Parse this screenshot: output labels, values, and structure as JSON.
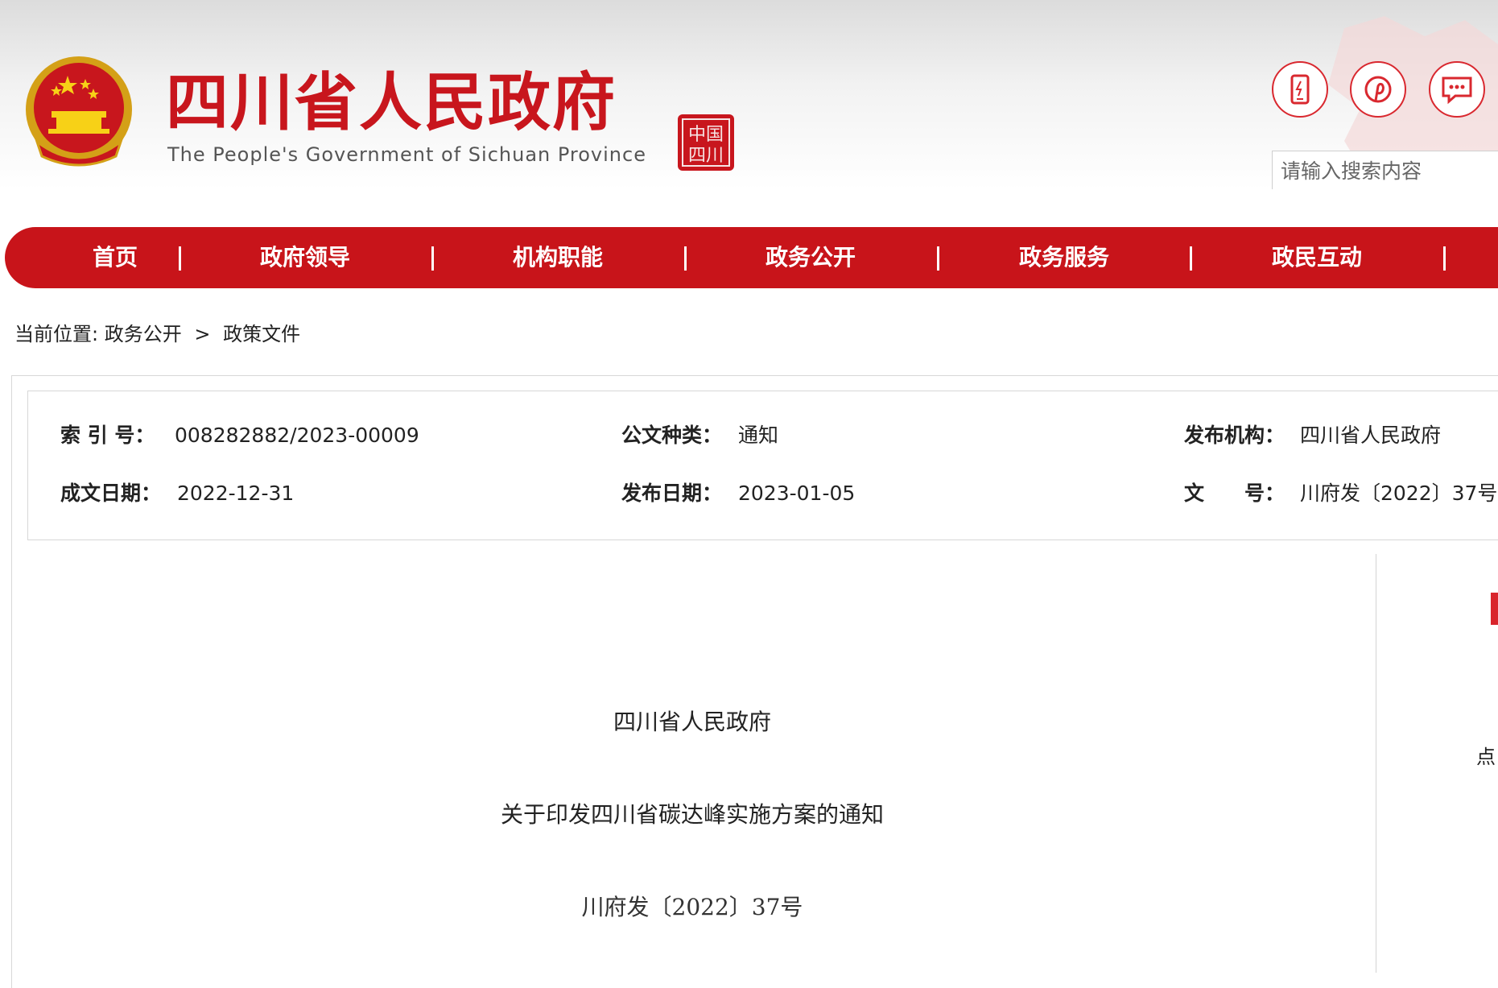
{
  "header": {
    "site_title": "四川省人民政府",
    "site_subtitle": "The People's Government of Sichuan Province",
    "seal_text": "中国四川",
    "icons": [
      "mobile-icon",
      "pinterest-icon",
      "message-icon"
    ],
    "search_placeholder": "请输入搜索内容"
  },
  "nav": {
    "items": [
      "首页",
      "政府领导",
      "机构职能",
      "政务公开",
      "政务服务",
      "政民互动"
    ]
  },
  "breadcrumb": {
    "prefix": "当前位置:",
    "path": [
      "政务公开",
      "政策文件"
    ],
    "separator": ">"
  },
  "meta": {
    "index_label": "索 引 号：",
    "index_value": "008282882/2023-00009",
    "type_label": "公文种类：",
    "type_value": "通知",
    "publisher_label": "发布机构：",
    "publisher_value": "四川省人民政府",
    "created_label": "成文日期：",
    "created_value": "2022-12-31",
    "published_label": "发布日期：",
    "published_value": "2023-01-05",
    "doc_no_label": "文　　号：",
    "doc_no_value": "川府发〔2022〕37号"
  },
  "document": {
    "issuer": "四川省人民政府",
    "title": "关于印发四川省碳达峰实施方案的通知",
    "doc_number": "川府发〔2022〕37号"
  },
  "sidebar": {
    "partial_text": "点"
  },
  "colors": {
    "brand_red": "#c8161d",
    "nav_red": "#c8141a"
  }
}
